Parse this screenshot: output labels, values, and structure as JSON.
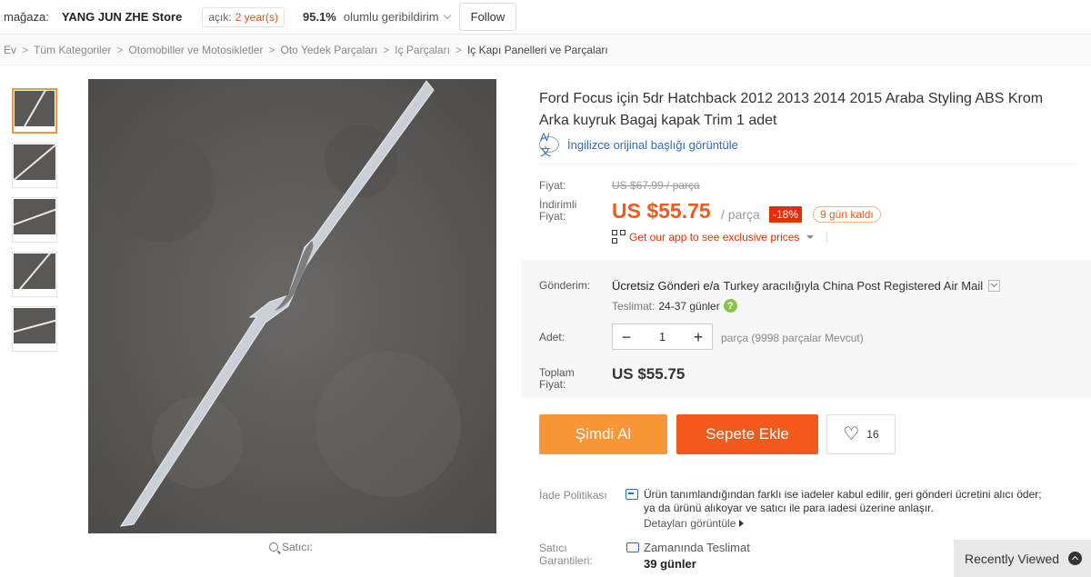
{
  "store": {
    "label": "mağaza:",
    "name": "YANG JUN ZHE Store",
    "open_prefix": "açık:",
    "open_years": "2 year(s)",
    "feedback_percent": "95.1%",
    "feedback_text": "olumlu geribildirim",
    "follow": "Follow"
  },
  "breadcrumb": [
    "Ev",
    "Tüm Kategoriler",
    "Otomobiller ve Motosikletler",
    "Oto Yedek Parçaları",
    "Iç Parçaları",
    "Iç Kapı Panelleri ve Parçaları"
  ],
  "gallery": {
    "thumbnail_count": 5,
    "active_index": 0,
    "caption": "Satıcı:"
  },
  "product": {
    "title": "Ford Focus için 5dr Hatchback 2012 2013 2014 2015 Araba Styling ABS Krom Arka kuyruk Bagaj kapak Trim 1 adet",
    "translate_icon": "A/文",
    "translate_link": "İngilizce orijinal başlığı görüntüle"
  },
  "price": {
    "label": "Fiyat:",
    "original": "US $67.99 / parça",
    "discount_label": "İndirimli Fiyat:",
    "discounted": "US $55.75",
    "per_unit": "/ parça",
    "discount_badge": "-18%",
    "days_left": "9 gün kaldı",
    "app_promo": "Get our app to see exclusive prices"
  },
  "shipping": {
    "label": "Gönderim:",
    "method_bold": "Ücretsiz Gönderi e/a",
    "method_rest": "Turkey aracılığıyla China Post Registered Air Mail",
    "delivery_label": "Teslimat:",
    "delivery_days": "24-37 günler",
    "help_icon": "?"
  },
  "quantity": {
    "label": "Adet:",
    "value": "1",
    "minus": "−",
    "plus": "+",
    "stock": "parça (9998 parçalar Mevcut)"
  },
  "total": {
    "label": "Toplam Fiyat:",
    "value": "US $55.75"
  },
  "actions": {
    "buy_now": "Şimdi Al",
    "add_to_cart": "Sepete Ekle",
    "heart": "♡",
    "wishlist_count": "16"
  },
  "returns": {
    "label": "İade Politikası",
    "text": "Ürün tanımlandığından farklı ise iadeler kabul edilir, geri gönderi ücretini alıcı öder; ya da ürünü alıkoyar ve satıcı ile para iadesi üzerine anlaşır.",
    "details": "Detayları görüntüle"
  },
  "guarantee": {
    "label": "Satıcı Garantileri:",
    "title": "Zamanında Teslimat",
    "days": "39 günler"
  },
  "recently_viewed": "Recently Viewed",
  "colors": {
    "accent_orange": "#f89636",
    "cart_red_orange": "#f2591b",
    "discount_red": "#e62e04",
    "link_blue": "#2e6bbf"
  }
}
